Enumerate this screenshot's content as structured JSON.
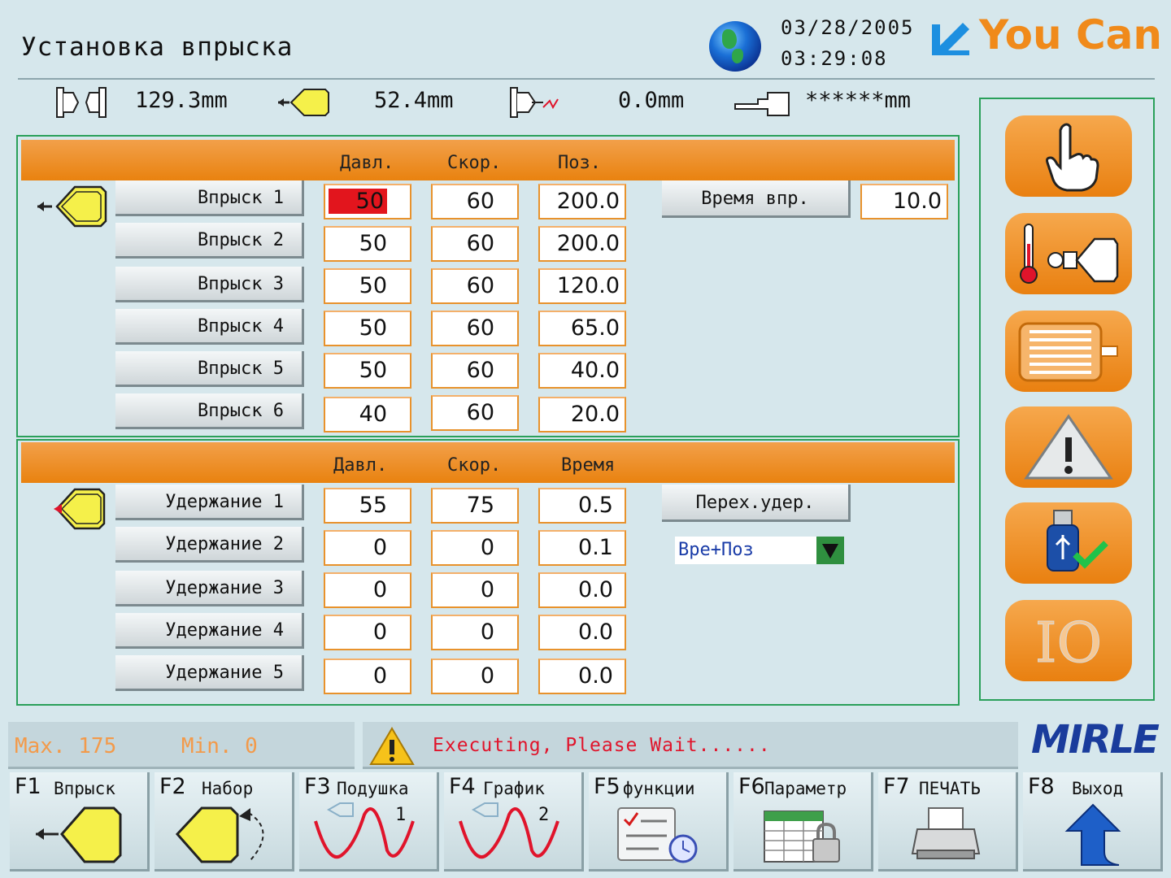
{
  "header": {
    "title": "Установка впрыска",
    "date": "03/28/2005",
    "time": "03:29:08",
    "brand": "You Can"
  },
  "readings": [
    {
      "icon": "mold-open-icon",
      "value": "129.3mm"
    },
    {
      "icon": "injection-position-icon",
      "value": "52.4mm"
    },
    {
      "icon": "ejector-icon",
      "value": "0.0mm"
    },
    {
      "icon": "core-pull-icon",
      "value": "******mm"
    }
  ],
  "injection": {
    "columns": [
      "Давл.",
      "Скор.",
      "Поз."
    ],
    "rows": [
      {
        "label": "Впрыск  1",
        "pressure": "50",
        "speed": "60",
        "position": "200.0"
      },
      {
        "label": "Впрыск  2",
        "pressure": "50",
        "speed": "60",
        "position": "200.0"
      },
      {
        "label": "Впрыск  3",
        "pressure": "50",
        "speed": "60",
        "position": "120.0"
      },
      {
        "label": "Впрыск  4",
        "pressure": "50",
        "speed": "60",
        "position": "65.0"
      },
      {
        "label": "Впрыск  5",
        "pressure": "50",
        "speed": "60",
        "position": "40.0"
      },
      {
        "label": "Впрыск  6",
        "pressure": "40",
        "speed": "60",
        "position": "20.0"
      }
    ],
    "time_button": "Время впр.",
    "time_value": "10.0"
  },
  "holding": {
    "columns": [
      "Давл.",
      "Скор.",
      "Время"
    ],
    "rows": [
      {
        "label": "Удержание  1",
        "pressure": "55",
        "speed": "75",
        "time": "0.5"
      },
      {
        "label": "Удержание  2",
        "pressure": "0",
        "speed": "0",
        "time": "0.1"
      },
      {
        "label": "Удержание  3",
        "pressure": "0",
        "speed": "0",
        "time": "0.0"
      },
      {
        "label": "Удержание  4",
        "pressure": "0",
        "speed": "0",
        "time": "0.0"
      },
      {
        "label": "Удержание  5",
        "pressure": "0",
        "speed": "0",
        "time": "0.0"
      }
    ],
    "transfer_button": "Перех.удер.",
    "transfer_mode": "Вре+Поз"
  },
  "sidebar": {
    "buttons": [
      {
        "icon": "manual-hand-icon"
      },
      {
        "icon": "temperature-nozzle-icon"
      },
      {
        "icon": "motor-icon"
      },
      {
        "icon": "alarm-warning-icon"
      },
      {
        "icon": "usb-drive-icon"
      },
      {
        "icon": "io-icon",
        "text": "IO"
      }
    ]
  },
  "status": {
    "max_label": "Max. 175",
    "min_label": "Min. 0",
    "message": "Executing, Please Wait......",
    "vendor": "MIRLE"
  },
  "function_keys": [
    {
      "num": "F1",
      "label": "Впрыск",
      "icon": "injection-icon"
    },
    {
      "num": "F2",
      "label": "Набор",
      "icon": "charge-icon"
    },
    {
      "num": "F3",
      "label": "Подушка",
      "sub": "1",
      "icon": "cushion-curve-icon"
    },
    {
      "num": "F4",
      "label": "График",
      "sub": "2",
      "icon": "graph-curve-icon"
    },
    {
      "num": "F5",
      "label": "функции",
      "icon": "checklist-clock-icon"
    },
    {
      "num": "F6",
      "label": "Параметр",
      "icon": "spreadsheet-lock-icon"
    },
    {
      "num": "F7",
      "label": "ПЕЧАТЬ",
      "icon": "printer-icon"
    },
    {
      "num": "F8",
      "label": "Выход",
      "icon": "exit-arrow-icon"
    }
  ],
  "colors": {
    "accent_orange": "#e9820f",
    "panel_border": "#2aa05a",
    "alert_red": "#e0142b",
    "selected_cell": "#e2151d"
  }
}
